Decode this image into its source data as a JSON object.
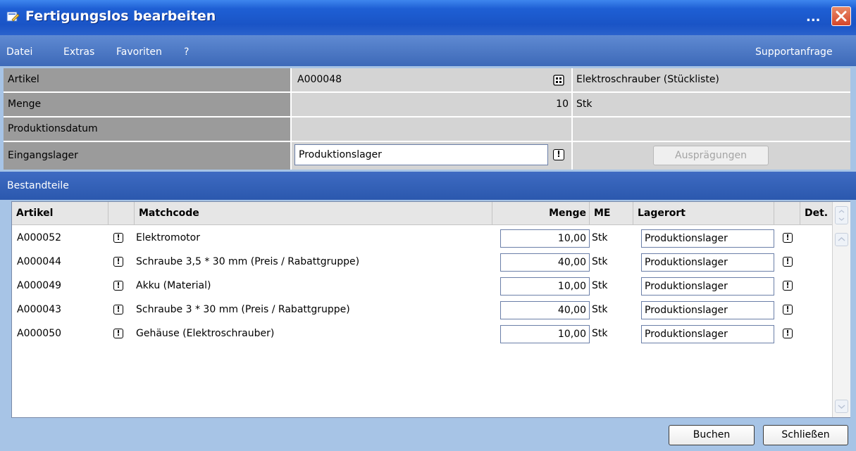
{
  "window": {
    "title": "Fertigungslos bearbeiten",
    "title_dots": "...",
    "close_glyph": "close-icon"
  },
  "menu": {
    "items": [
      "Datei",
      "Extras",
      "Favoriten",
      "?"
    ],
    "support": "Supportanfrage"
  },
  "header": {
    "artikel_label": "Artikel",
    "artikel_value": "A000048",
    "artikel_desc": "Elektroschrauber (Stückliste)",
    "menge_label": "Menge",
    "menge_value": "10",
    "menge_unit": "Stk",
    "produktionsdatum_label": "Produktionsdatum",
    "eingangslager_label": "Eingangslager",
    "eingangslager_value": "Produktionslager",
    "auspraegungen_button": "Ausprägungen"
  },
  "section": {
    "title": "Bestandteile"
  },
  "table": {
    "columns": [
      "Artikel",
      "",
      "Matchcode",
      "Menge",
      "ME",
      "Lagerort",
      "",
      "Det."
    ],
    "rows": [
      {
        "artikel": "A000052",
        "matchcode": "Elektromotor",
        "menge": "10,00",
        "me": "Stk",
        "lagerort": "Produktionslager"
      },
      {
        "artikel": "A000044",
        "matchcode": "Schraube 3,5 * 30 mm (Preis / Rabattgruppe)",
        "menge": "40,00",
        "me": "Stk",
        "lagerort": "Produktionslager"
      },
      {
        "artikel": "A000049",
        "matchcode": "Akku (Material)",
        "menge": "10,00",
        "me": "Stk",
        "lagerort": "Produktionslager"
      },
      {
        "artikel": "A000043",
        "matchcode": "Schraube 3 * 30 mm (Preis / Rabattgruppe)",
        "menge": "40,00",
        "me": "Stk",
        "lagerort": "Produktionslager"
      },
      {
        "artikel": "A000050",
        "matchcode": "Gehäuse (Elektroschrauber)",
        "menge": "10,00",
        "me": "Stk",
        "lagerort": "Produktionslager"
      }
    ]
  },
  "footer": {
    "buchen": "Buchen",
    "schliessen": "Schließen"
  },
  "colors": {
    "titlebar": "#1e5fd4",
    "menubar": "#4a76c4",
    "background": "#a7c4e6",
    "label_bg": "#9b9b9b",
    "value_bg": "#d4d4d4"
  }
}
